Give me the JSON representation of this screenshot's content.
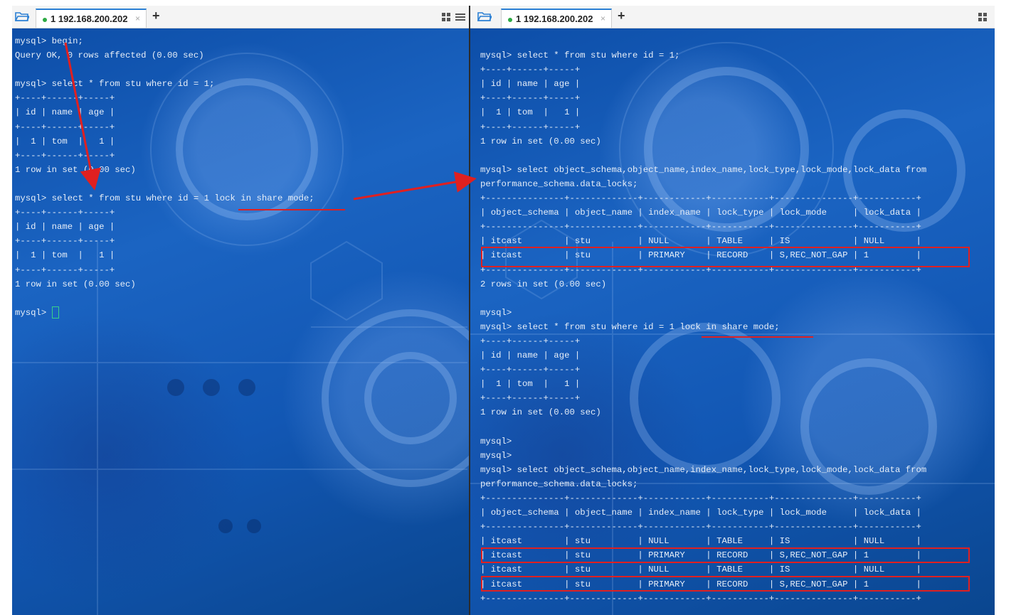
{
  "left_pane": {
    "tab_label": "1 192.168.200.202",
    "tab_close": "×",
    "new_tab": "+",
    "terminal_lines": [
      "mysql> begin;",
      "Query OK, 0 rows affected (0.00 sec)",
      "",
      "mysql> select * from stu where id = 1;",
      "+----+------+-----+",
      "| id | name | age |",
      "+----+------+-----+",
      "|  1 | tom  |   1 |",
      "+----+------+-----+",
      "1 row in set (0.00 sec)",
      "",
      "mysql> select * from stu where id = 1 lock in share mode;",
      "+----+------+-----+",
      "| id | name | age |",
      "+----+------+-----+",
      "|  1 | tom  |   1 |",
      "+----+------+-----+",
      "1 row in set (0.00 sec)",
      "",
      "mysql> "
    ]
  },
  "right_pane": {
    "tab_label": "1 192.168.200.202",
    "tab_close": "×",
    "new_tab": "+",
    "terminal_lines": [
      "",
      "mysql> select * from stu where id = 1;",
      "+----+------+-----+",
      "| id | name | age |",
      "+----+------+-----+",
      "|  1 | tom  |   1 |",
      "+----+------+-----+",
      "1 row in set (0.00 sec)",
      "",
      "mysql> select object_schema,object_name,index_name,lock_type,lock_mode,lock_data from",
      "performance_schema.data_locks;",
      "+---------------+-------------+------------+-----------+---------------+-----------+",
      "| object_schema | object_name | index_name | lock_type | lock_mode     | lock_data |",
      "+---------------+-------------+------------+-----------+---------------+-----------+",
      "| itcast        | stu         | NULL       | TABLE     | IS            | NULL      |",
      "| itcast        | stu         | PRIMARY    | RECORD    | S,REC_NOT_GAP | 1         |",
      "+---------------+-------------+------------+-----------+---------------+-----------+",
      "2 rows in set (0.00 sec)",
      "",
      "mysql>",
      "mysql> select * from stu where id = 1 lock in share mode;",
      "+----+------+-----+",
      "| id | name | age |",
      "+----+------+-----+",
      "|  1 | tom  |   1 |",
      "+----+------+-----+",
      "1 row in set (0.00 sec)",
      "",
      "mysql>",
      "mysql>",
      "mysql> select object_schema,object_name,index_name,lock_type,lock_mode,lock_data from",
      "performance_schema.data_locks;",
      "+---------------+-------------+------------+-----------+---------------+-----------+",
      "| object_schema | object_name | index_name | lock_type | lock_mode     | lock_data |",
      "+---------------+-------------+------------+-----------+---------------+-----------+",
      "| itcast        | stu         | NULL       | TABLE     | IS            | NULL      |",
      "| itcast        | stu         | PRIMARY    | RECORD    | S,REC_NOT_GAP | 1         |",
      "| itcast        | stu         | NULL       | TABLE     | IS            | NULL      |",
      "| itcast        | stu         | PRIMARY    | RECORD    | S,REC_NOT_GAP | 1         |",
      "+---------------+-------------+------------+-----------+---------------+-----------+"
    ]
  },
  "annotations": {
    "color": "#e02020"
  },
  "icons": {
    "folder": "folder-icon",
    "layout": "layout-grid-icon",
    "menu": "menu-icon"
  }
}
